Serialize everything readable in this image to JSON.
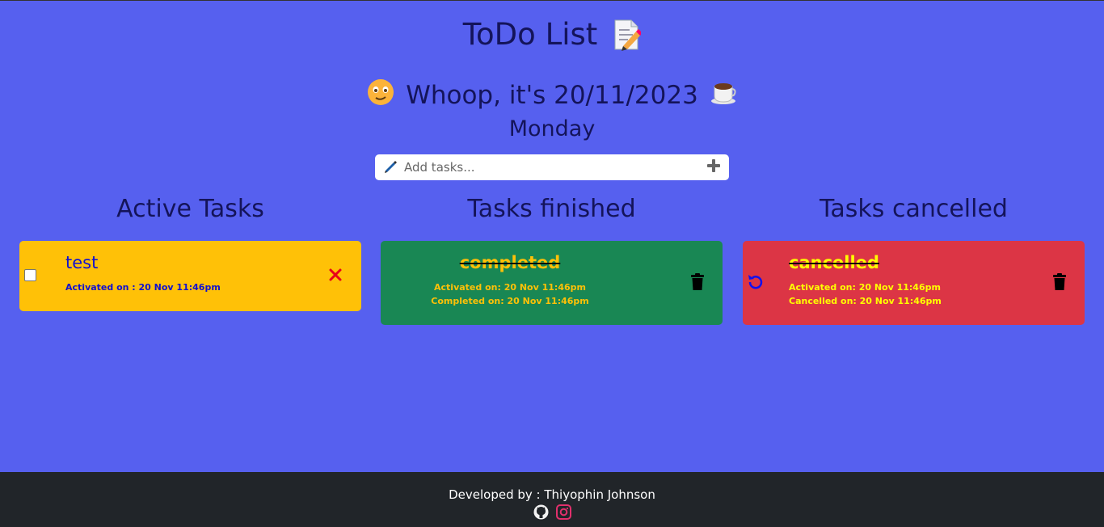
{
  "header": {
    "title": "ToDo List",
    "greeting": "Whoop, it's 20/11/2023",
    "day": "Monday"
  },
  "add_task": {
    "placeholder": "Add tasks..."
  },
  "columns": {
    "active": "Active Tasks",
    "finished": "Tasks finished",
    "cancelled": "Tasks cancelled"
  },
  "active_tasks": [
    {
      "name": "test",
      "activated": "Activated on : 20 Nov 11:46pm"
    }
  ],
  "finished_tasks": [
    {
      "name": "completed",
      "activated": "Activated on: 20 Nov 11:46pm",
      "completed": "Completed on: 20 Nov 11:46pm"
    }
  ],
  "cancelled_tasks": [
    {
      "name": "cancelled",
      "activated": "Activated on: 20 Nov 11:46pm",
      "cancelled": "Cancelled on: 20 Nov 11:46pm"
    }
  ],
  "footer": {
    "credit": "Developed by : Thiyophin Johnson"
  },
  "colors": {
    "background": "#5660ef",
    "active_card": "#ffc107",
    "finished_card": "#198754",
    "cancelled_card": "#dc3545",
    "footer": "#212529"
  },
  "icons": [
    "memo-icon",
    "smiley-icon",
    "coffee-icon",
    "pen-icon",
    "plus-icon",
    "close-icon",
    "trash-icon",
    "undo-icon",
    "github-icon",
    "instagram-icon"
  ]
}
